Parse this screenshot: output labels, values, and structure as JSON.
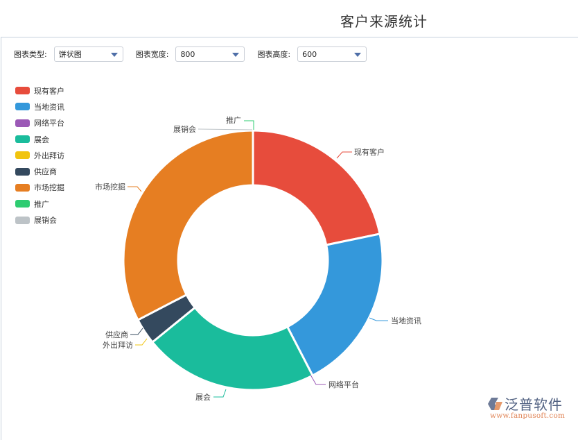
{
  "page": {
    "title": "客户来源统计"
  },
  "toolbar": {
    "chart_type": {
      "label": "图表类型:",
      "value": "饼状图"
    },
    "chart_width": {
      "label": "图表宽度:",
      "value": "800"
    },
    "chart_height": {
      "label": "图表高度:",
      "value": "600"
    }
  },
  "chart_data": {
    "type": "pie",
    "variant": "donut",
    "title": "客户来源统计",
    "legend_position": "top-left",
    "categories": [
      "现有客户",
      "当地资讯",
      "网络平台",
      "展会",
      "外出拜访",
      "供应商",
      "市场挖掘",
      "推广",
      "展销会"
    ],
    "values": [
      20,
      19,
      0,
      20,
      0,
      3,
      30,
      0,
      0
    ],
    "colors": [
      "#e74c3c",
      "#3498db",
      "#9b59b6",
      "#1abc9c",
      "#f1c40f",
      "#34495e",
      "#e67e22",
      "#2ecc71",
      "#bdc3c7"
    ]
  },
  "logo": {
    "name": "泛普软件",
    "url": "www.fanpusoft.com"
  }
}
